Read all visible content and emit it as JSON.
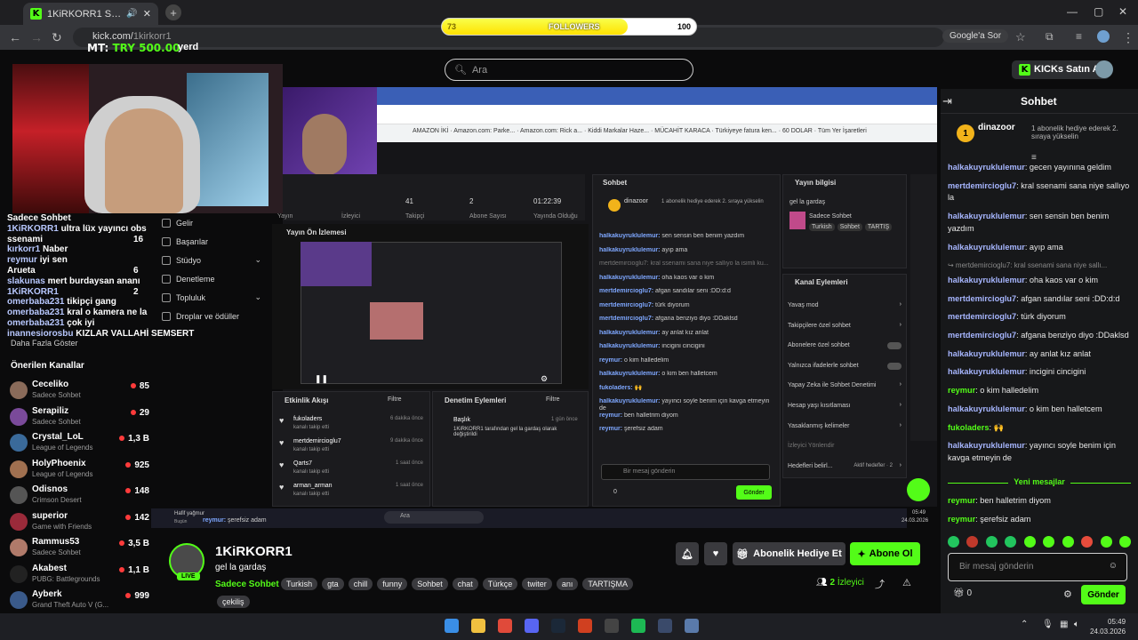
{
  "browser": {
    "tab_title": "1KiRKORR1 Stream - Watch",
    "url_host": "kick.com/",
    "url_path": "1kirkorr1",
    "google_search": "Google'a Sor"
  },
  "overlay": {
    "followers_label": "FOLLOWERS",
    "followers_current": "73",
    "followers_goal": "100",
    "followers_progress": 0.73,
    "mt_label": "MT:",
    "mt_value": "TRY 500.00",
    "yerd": "yerd"
  },
  "kick": {
    "search_placeholder": "Ara",
    "kicks_button": "KICKs Satın Al"
  },
  "stream_overlay_chat": [
    {
      "user": "",
      "text": "Sadece Sohbet"
    },
    {
      "user": "1KiRKORR1",
      "text": "ultra lüx yayıncı obs"
    },
    {
      "user": "",
      "text": "ssenami",
      "num": "16"
    },
    {
      "user": "kırkorr1",
      "text": "Naber"
    },
    {
      "user": "reymur",
      "text": "iyi sen"
    },
    {
      "user": "",
      "text": "Arueta",
      "num": "6"
    },
    {
      "user": "slakunas",
      "text": "mert burdaysan ananı"
    },
    {
      "user": "1KiRKORR1",
      "text": "",
      "num": "2"
    },
    {
      "user": "omerbaba231",
      "text": "tikipçi gang"
    },
    {
      "user": "omerbaba231",
      "text": "kral o kamera ne la"
    },
    {
      "user": "omerbaba231",
      "text": "çok iyi"
    },
    {
      "user": "inannesiorosbu",
      "text": "KIZLAR VALLAHİ SEMSERT"
    }
  ],
  "menu": [
    "Gelir",
    "Başarılar",
    "Stüdyo",
    "Denetleme",
    "Topluluk",
    "Droplar ve ödüller"
  ],
  "sidebar": {
    "more": "Daha Fazla Göster",
    "recommended_title": "Önerilen Kanallar"
  },
  "recommended": [
    {
      "name": "Ceceliko",
      "cat": "Sadece Sohbet",
      "viewers": "85",
      "color": "#8a6b5a"
    },
    {
      "name": "Serapiliz",
      "cat": "Sadece Sohbet",
      "viewers": "29",
      "color": "#7a4a9a"
    },
    {
      "name": "Crystal_LoL",
      "cat": "League of Legends",
      "viewers": "1,3 B",
      "color": "#3a6a9a"
    },
    {
      "name": "HolyPhoenix",
      "cat": "League of Legends",
      "viewers": "925",
      "color": "#a07050"
    },
    {
      "name": "Odisnos",
      "cat": "Crimson Desert",
      "viewers": "148",
      "color": "#555"
    },
    {
      "name": "superior",
      "cat": "Game with Friends",
      "viewers": "142",
      "color": "#9a2a3a"
    },
    {
      "name": "Rammus53",
      "cat": "Sadece Sohbet",
      "viewers": "3,5 B",
      "color": "#b07a6a"
    },
    {
      "name": "Akabest",
      "cat": "PUBG: Battlegrounds",
      "viewers": "1,1 B",
      "color": "#222"
    },
    {
      "name": "Ayberk",
      "cat": "Grand Theft Auto V (G...",
      "viewers": "999",
      "color": "#3a5a8a"
    }
  ],
  "obs": {
    "stats": [
      {
        "v": "41",
        "l": "Takipçi"
      },
      {
        "v": "2",
        "l": "Abone Sayısı"
      },
      {
        "v": "01:22:39",
        "l": "Yayında Olduğu"
      }
    ],
    "stat_yayin": "Yayın",
    "stat_izleyici": "İzleyici",
    "preview_title": "Yayın Ön İzlemesi",
    "chat_title": "Sohbet",
    "pin_user": "dinazoor",
    "pin_text": "1 abonelik hediye ederek 2. sıraya yükselin",
    "chat": [
      {
        "u": "halkakuyruklulemur",
        "t": "sen sensin ben benim yazdım"
      },
      {
        "u": "halkakuyruklulemur",
        "t": "ayıp ama"
      },
      {
        "u": "",
        "t": "mertdemircioglu7: kral ssenami sana niye sallıyo la isimli ku..."
      },
      {
        "u": "halkakuyruklulemur",
        "t": "oha kaos var o kim"
      },
      {
        "u": "mertdemircioglu7",
        "t": "afgan sandılar seni :DD:d:d"
      },
      {
        "u": "mertdemircioglu7",
        "t": "türk diyorum"
      },
      {
        "u": "mertdemircioglu7",
        "t": "afgana benziyo diyo :DDaklsd"
      },
      {
        "u": "halkakuyruklulemur",
        "t": "ay anlat kız anlat"
      },
      {
        "u": "halkakuyruklulemur",
        "t": "incigini cincigini"
      },
      {
        "u": "reymur",
        "t": "o kim halledelim"
      },
      {
        "u": "halkakuyruklulemur",
        "t": "o kim ben halletcem"
      },
      {
        "u": "fukoladers",
        "t": "🙌"
      },
      {
        "u": "halkakuyruklulemur",
        "t": "yayıncı soyle benim için kavga etmeyin de"
      },
      {
        "u": "reymur",
        "t": "ben halletrim diyom"
      },
      {
        "u": "reymur",
        "t": "şerefsiz adam"
      }
    ],
    "input_placeholder": "Bir mesaj gönderin",
    "send": "Gönder",
    "count": "0",
    "info_title": "Yayın bilgisi",
    "info_stream": "gel la gardaş",
    "info_cat": "Sadece Sohbet",
    "info_tags": [
      "Turkish",
      "Sohbet",
      "TARTIŞ"
    ],
    "actions_title": "Kanal Eylemleri",
    "actions": [
      "Yavaş mod",
      "Takipçilere özel sohbet",
      "Abonelere özel sohbet",
      "Yalnızca ifadelerle sohbet",
      "Yapay Zeka ile Sohbet Denetimi",
      "Hesap yaşı kısıtlaması",
      "Yasaklanmış kelimeler",
      "İzleyici Yönlendir",
      "Hedefleri belirl..."
    ],
    "action_goal": "Aktif hedefler · 2",
    "activity_title": "Etkinlik Akışı",
    "filter": "Filtre",
    "activity": [
      {
        "u": "fukoladers",
        "d": "kanalı takip etti",
        "t": "6 dakika önce"
      },
      {
        "u": "mertdemircioglu7",
        "d": "kanalı takip etti",
        "t": "9 dakika önce"
      },
      {
        "u": "Qarts7",
        "d": "kanalı takip etti",
        "t": "1 saat önce"
      },
      {
        "u": "arman_arman",
        "d": "kanalı takip etti",
        "t": "1 saat önce"
      }
    ],
    "mod_title": "Denetim Eylemleri",
    "mod_item": {
      "h": "Başlık",
      "d": "1KiRKORR1 tarafından gel la gardaş olarak değiştirildi",
      "t": "1 gün önce"
    },
    "weather": "Hafif yağmur",
    "weather_sub": "Bugün",
    "taskbar_search": "Ara",
    "tb_time": "05:49",
    "tb_date": "24.03.2026"
  },
  "stream": {
    "name": "1KiRKORR1",
    "title": "gel la gardaş",
    "category": "Sadece Sohbet",
    "live": "LIVE",
    "tags": [
      "Turkish",
      "gta",
      "chill",
      "funny",
      "Sohbet",
      "chat",
      "Türkçe",
      "twiter",
      "anı",
      "TARTIŞMA"
    ],
    "tag2": "çekiliş",
    "gift_btn": "Abonelik Hediye Et",
    "sub_btn": "Abone Ol",
    "viewers": "2",
    "viewers_label": "İzleyici"
  },
  "chat": {
    "title": "Sohbet",
    "pin_user": "dinazoor",
    "pin_text": "1 abonelik hediye ederek 2. sıraya yükselin",
    "messages": [
      {
        "u": "halkakuyruklulemur",
        "t": "gecen yayınına geldim",
        "c": "u"
      },
      {
        "u": "mertdemircioglu7",
        "t": "kral ssenami sana niye sallıyo la",
        "c": "u"
      },
      {
        "u": "halkakuyruklulemur",
        "t": "sen sensin ben benim yazdım",
        "c": "u"
      },
      {
        "u": "halkakuyruklulemur",
        "t": "ayıp ama",
        "c": "u"
      },
      {
        "u": "",
        "t": "↪ mertdemircioglu7: kral ssenami sana niye sallı...",
        "c": "reply"
      },
      {
        "u": "halkakuyruklulemur",
        "t": "oha kaos var o kim",
        "c": "u"
      },
      {
        "u": "mertdemircioglu7",
        "t": "afgan sandılar seni :DD:d:d",
        "c": "u"
      },
      {
        "u": "mertdemircioglu7",
        "t": "türk diyorum",
        "c": "u"
      },
      {
        "u": "mertdemircioglu7",
        "t": "afgana benziyo diyo :DDaklsd",
        "c": "u"
      },
      {
        "u": "halkakuyruklulemur",
        "t": "ay anlat kız anlat",
        "c": "u"
      },
      {
        "u": "halkakuyruklulemur",
        "t": "incigini cincigini",
        "c": "u"
      },
      {
        "u": "reymur",
        "t": "o kim halledelim",
        "c": "u3"
      },
      {
        "u": "halkakuyruklulemur",
        "t": "o kim ben halletcem",
        "c": "u"
      },
      {
        "u": "fukoladers",
        "t": "🙌",
        "c": "u3"
      },
      {
        "u": "halkakuyruklulemur",
        "t": "yayıncı soyle benim için kavga etmeyin de",
        "c": "u"
      }
    ],
    "new_messages": "Yeni mesajlar",
    "after": [
      {
        "u": "reymur",
        "t": "ben halletrim diyom"
      },
      {
        "u": "reymur",
        "t": "şerefsiz adam"
      }
    ],
    "input_placeholder": "Bir mesaj gönderin",
    "send": "Gönder",
    "count": "0"
  },
  "taskbar": {
    "time": "05:49",
    "date": "24.03.2026"
  },
  "colors": {
    "accent": "#53fc18",
    "bg": "#0b0b0c",
    "chat_bg": "#17181a"
  }
}
